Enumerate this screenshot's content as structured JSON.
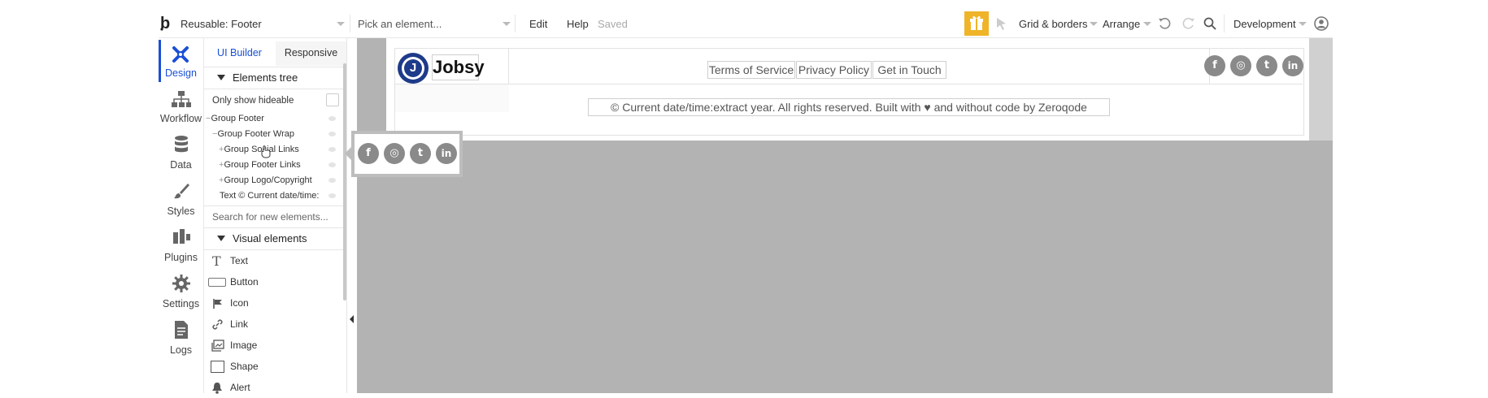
{
  "topbar": {
    "page_select": "Reusable: Footer",
    "element_picker_placeholder": "Pick an element...",
    "edit": "Edit",
    "help": "Help",
    "saved": "Saved",
    "grid_borders": "Grid & borders",
    "arrange": "Arrange",
    "environment": "Development"
  },
  "rail": {
    "items": [
      {
        "label": "Design",
        "icon": "design-icon"
      },
      {
        "label": "Workflow",
        "icon": "workflow-icon"
      },
      {
        "label": "Data",
        "icon": "database-icon"
      },
      {
        "label": "Styles",
        "icon": "brush-icon"
      },
      {
        "label": "Plugins",
        "icon": "plug-icon"
      },
      {
        "label": "Settings",
        "icon": "gear-icon"
      },
      {
        "label": "Logs",
        "icon": "document-icon"
      }
    ]
  },
  "panel": {
    "tab_ui_builder": "UI Builder",
    "tab_responsive": "Responsive",
    "elements_tree_title": "Elements tree",
    "only_show_hideable": "Only show hideable",
    "tree": [
      {
        "prefix": "−",
        "label": "Group Footer"
      },
      {
        "prefix": "−",
        "label": "Group Footer Wrap"
      },
      {
        "prefix": "+",
        "label": "Group Social Links"
      },
      {
        "prefix": "+",
        "label": "Group Footer Links"
      },
      {
        "prefix": "+",
        "label": "Group Logo/Copyright"
      },
      {
        "prefix": "",
        "label": "Text © Current date/time:"
      }
    ],
    "search_placeholder": "Search for new elements...",
    "visual_elements_title": "Visual elements",
    "visual_elements": [
      {
        "label": "Text",
        "icon": "text-icon"
      },
      {
        "label": "Button",
        "icon": "button-icon"
      },
      {
        "label": "Icon",
        "icon": "flag-icon"
      },
      {
        "label": "Link",
        "icon": "link-icon"
      },
      {
        "label": "Image",
        "icon": "image-icon"
      },
      {
        "label": "Shape",
        "icon": "shape-icon"
      },
      {
        "label": "Alert",
        "icon": "bell-icon"
      }
    ]
  },
  "canvas": {
    "logo_letter": "J",
    "brand": "Jobsy",
    "links": [
      "Terms of Service",
      "Privacy Policy",
      "Get in Touch"
    ],
    "copyright": "© Current date/time:extract year. All rights reserved. Built with ♥ and without code by Zeroqode",
    "social": [
      "f",
      "◎",
      "t",
      "in"
    ]
  },
  "colors": {
    "accent": "#1a4fd6",
    "canvas_bg": "#b3b3b3",
    "gift_badge": "#f0b429",
    "logo_blue": "#1e3a8a"
  }
}
